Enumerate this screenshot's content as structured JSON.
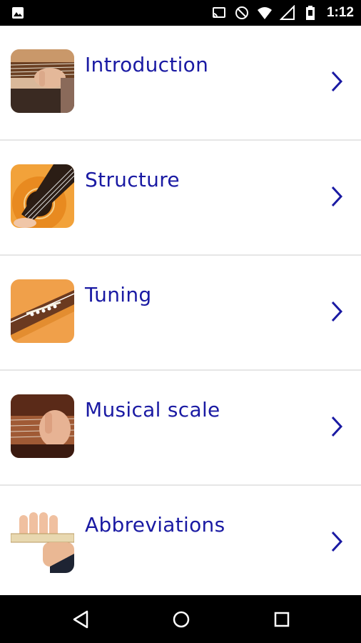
{
  "status_bar": {
    "time": "1:12",
    "icons": [
      "image-icon",
      "cast-icon",
      "do-not-disturb-icon",
      "wifi-icon",
      "signal-icon",
      "battery-icon"
    ]
  },
  "menu": {
    "items": [
      {
        "label": "Introduction",
        "thumb": "guitar-playing-thumbnail"
      },
      {
        "label": "Structure",
        "thumb": "guitar-body-thumbnail"
      },
      {
        "label": "Tuning",
        "thumb": "guitar-bridge-thumbnail"
      },
      {
        "label": "Musical scale",
        "thumb": "guitar-fretboard-thumbnail"
      },
      {
        "label": "Abbreviations",
        "thumb": "hand-capo-thumbnail"
      }
    ]
  },
  "nav_bar": {
    "icons": [
      "back-icon",
      "home-icon",
      "recent-apps-icon"
    ]
  },
  "colors": {
    "accent_text": "#1a1aa3",
    "divider": "#e6e6e6",
    "bars": "#000000"
  }
}
